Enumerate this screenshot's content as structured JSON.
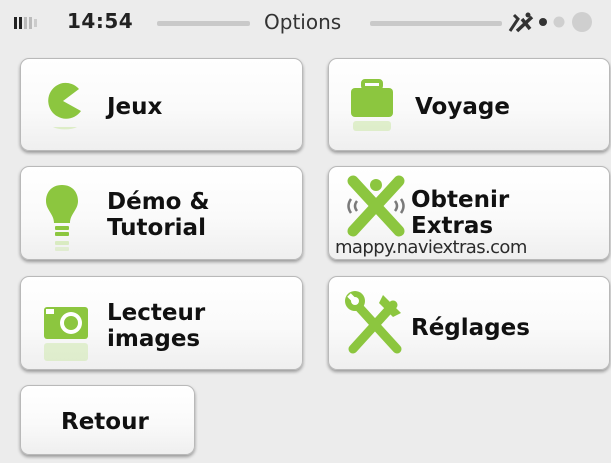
{
  "status_bar": {
    "time": "14:54",
    "title": "Options"
  },
  "menu": {
    "games_label": "Jeux",
    "travel_label": "Voyage",
    "demo_label": "Démo &\nTutorial",
    "extras_label": "Obtenir\nExtras",
    "extras_url": "mappy.naviextras.com",
    "viewer_label": "Lecteur\nimages",
    "settings_label": "Réglages",
    "back_label": "Retour"
  },
  "colors": {
    "accent": "#8cc63f",
    "background": "#ececec"
  }
}
